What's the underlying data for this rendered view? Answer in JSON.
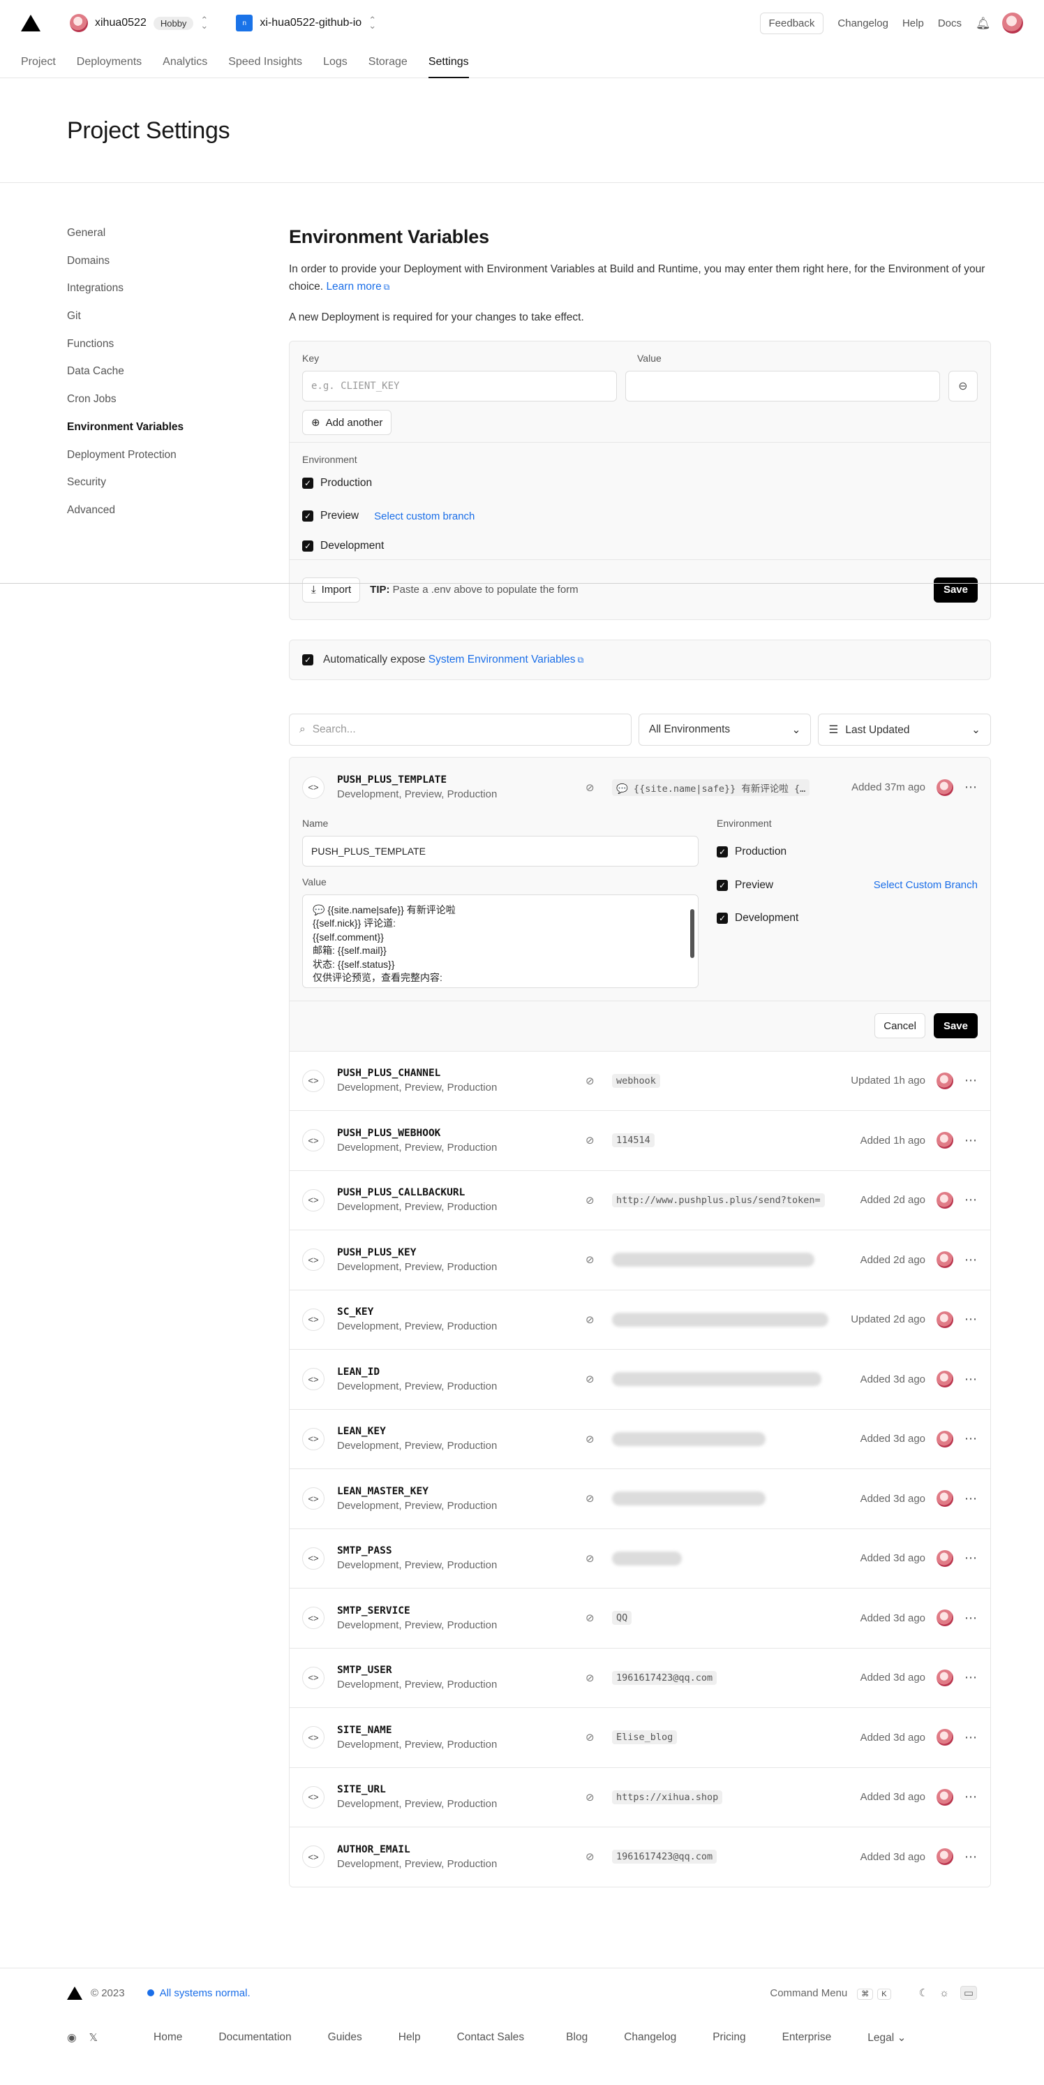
{
  "topbar": {
    "team_name": "xihua0522",
    "plan_badge": "Hobby",
    "project_name": "xi-hua0522-github-io",
    "links": [
      "Feedback",
      "Changelog",
      "Help",
      "Docs"
    ]
  },
  "tabs": [
    "Project",
    "Deployments",
    "Analytics",
    "Speed Insights",
    "Logs",
    "Storage",
    "Settings"
  ],
  "page_title": "Project Settings",
  "sidebar": [
    "General",
    "Domains",
    "Integrations",
    "Git",
    "Functions",
    "Data Cache",
    "Cron Jobs",
    "Environment Variables",
    "Deployment Protection",
    "Security",
    "Advanced"
  ],
  "env": {
    "title": "Environment Variables",
    "desc": "In order to provide your Deployment with Environment Variables at Build and Runtime, you may enter them right here, for the Environment of your choice.",
    "learn_more": "Learn more",
    "note": "A new Deployment is required for your changes to take effect.",
    "key_label": "Key",
    "value_label": "Value",
    "key_placeholder": "e.g. CLIENT_KEY",
    "add_another": "Add another",
    "environment_label": "Environment",
    "env_options": [
      "Production",
      "Preview",
      "Development"
    ],
    "select_branch": "Select custom branch",
    "import": "Import",
    "tip_bold": "TIP:",
    "tip_text": "Paste a .env above to populate the form",
    "save": "Save",
    "auto_expose": "Automatically expose",
    "system_env_link": "System Environment Variables"
  },
  "filters": {
    "search_placeholder": "Search...",
    "env_select": "All Environments",
    "sort_select": "Last Updated"
  },
  "expanded": {
    "key": "PUSH_PLUS_TEMPLATE",
    "envs": "Development, Preview, Production",
    "preview": "💬 {{site.name|safe}} 有新评论啦 {…",
    "time": "Added 37m ago",
    "name_label": "Name",
    "name_value": "PUSH_PLUS_TEMPLATE",
    "value_label": "Value",
    "value_lines": [
      "💬 {{site.name|safe}} 有新评论啦",
      "{{self.nick}} 评论道:",
      "{{self.comment}}",
      "邮箱: {{self.mail}}",
      "状态: {{self.status}}",
      "仅供评论预览，查看完整内容:"
    ],
    "environment_label": "Environment",
    "env_options": [
      "Production",
      "Preview",
      "Development"
    ],
    "select_branch": "Select Custom Branch",
    "cancel": "Cancel",
    "save": "Save"
  },
  "rows": [
    {
      "key": "PUSH_PLUS_CHANNEL",
      "envs": "Development, Preview, Production",
      "value": "webhook",
      "time": "Updated 1h ago"
    },
    {
      "key": "PUSH_PLUS_WEBHOOK",
      "envs": "Development, Preview, Production",
      "value": "114514",
      "time": "Added 1h ago"
    },
    {
      "key": "PUSH_PLUS_CALLBACKURL",
      "envs": "Development, Preview, Production",
      "value": "http://www.pushplus.plus/send?token=",
      "time": "Added 2d ago"
    },
    {
      "key": "PUSH_PLUS_KEY",
      "envs": "Development, Preview, Production",
      "value": "",
      "time": "Added 2d ago"
    },
    {
      "key": "SC_KEY",
      "envs": "Development, Preview, Production",
      "value": "",
      "time": "Updated 2d ago"
    },
    {
      "key": "LEAN_ID",
      "envs": "Development, Preview, Production",
      "value": "",
      "time": "Added 3d ago"
    },
    {
      "key": "LEAN_KEY",
      "envs": "Development, Preview, Production",
      "value": "",
      "time": "Added 3d ago"
    },
    {
      "key": "LEAN_MASTER_KEY",
      "envs": "Development, Preview, Production",
      "value": "",
      "time": "Added 3d ago"
    },
    {
      "key": "SMTP_PASS",
      "envs": "Development, Preview, Production",
      "value": "",
      "time": "Added 3d ago"
    },
    {
      "key": "SMTP_SERVICE",
      "envs": "Development, Preview, Production",
      "value": "QQ",
      "time": "Added 3d ago"
    },
    {
      "key": "SMTP_USER",
      "envs": "Development, Preview, Production",
      "value": "1961617423@qq.com",
      "time": "Added 3d ago"
    },
    {
      "key": "SITE_NAME",
      "envs": "Development, Preview, Production",
      "value": "Elise_blog",
      "time": "Added 3d ago"
    },
    {
      "key": "SITE_URL",
      "envs": "Development, Preview, Production",
      "value": "https://xihua.shop",
      "time": "Added 3d ago"
    },
    {
      "key": "AUTHOR_EMAIL",
      "envs": "Development, Preview, Production",
      "value": "1961617423@qq.com",
      "time": "Added 3d ago"
    }
  ],
  "footer": {
    "copyright": "© 2023",
    "status": "All systems normal.",
    "command_menu": "Command Menu",
    "kbd1": "⌘",
    "kbd2": "K",
    "links": [
      "Home",
      "Documentation",
      "Guides",
      "Help",
      "Contact Sales",
      "Blog",
      "Changelog",
      "Pricing",
      "Enterprise",
      "Legal"
    ]
  }
}
